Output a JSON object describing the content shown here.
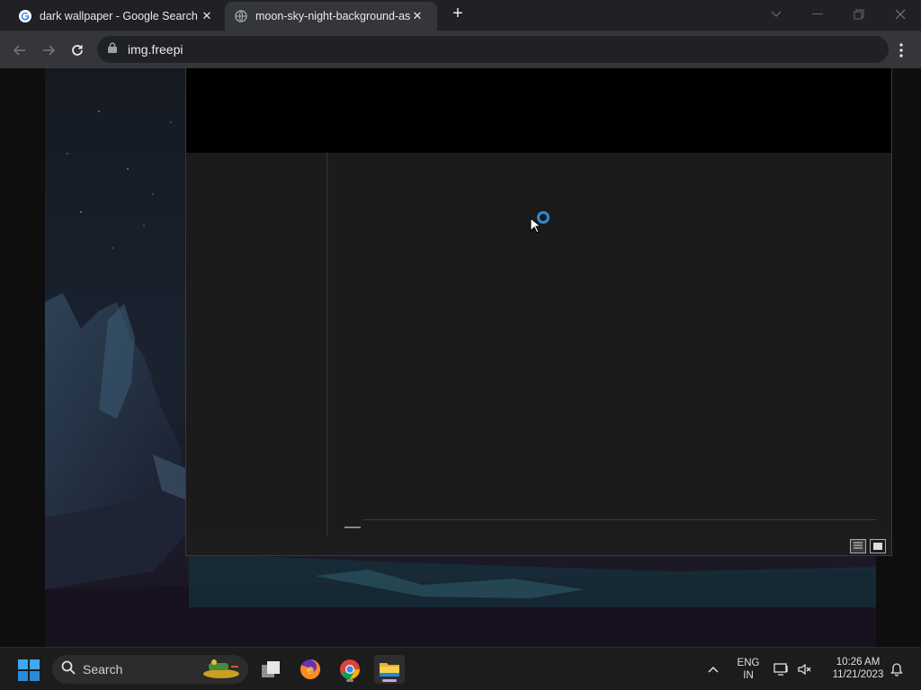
{
  "browser": {
    "tabs": [
      {
        "title": "dark wallpaper - Google Search",
        "icon": "google-icon",
        "active": false
      },
      {
        "title": "moon-sky-night-background-as",
        "icon": "globe-icon",
        "active": true
      }
    ],
    "url": "img.freepi"
  },
  "dialog": {
    "controls": [
      "minimize-icon",
      "maximize-icon",
      "close-icon"
    ]
  },
  "taskbar": {
    "search_placeholder": "Search",
    "apps": [
      "task-view-icon",
      "firefox-icon",
      "chrome-icon",
      "file-explorer-icon"
    ],
    "language": {
      "line1": "ENG",
      "line2": "IN"
    },
    "time": "10:26 AM",
    "date": "11/21/2023"
  },
  "colors": {
    "accent": "#2b8ad6",
    "taskbar_bg": "#1c1c1c",
    "chrome_tabbar": "#202124",
    "chrome_toolbar": "#35363a"
  }
}
